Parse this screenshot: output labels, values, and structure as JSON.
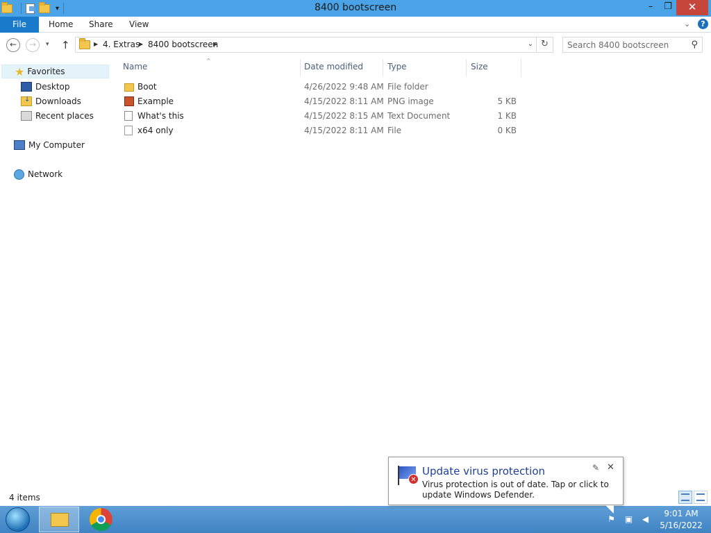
{
  "window": {
    "title": "8400 bootscreen",
    "minimize_glyph": "–",
    "maximize_glyph": "❐",
    "close_glyph": "✕"
  },
  "ribbon": {
    "tabs": [
      "File",
      "Home",
      "Share",
      "View"
    ],
    "expand_glyph": "⌄",
    "help_glyph": "?"
  },
  "address": {
    "back_glyph": "←",
    "forward_glyph": "→",
    "recent_glyph": "▾",
    "up_glyph": "↑",
    "breadcrumb": [
      "4. Extras",
      "8400 bootscreen"
    ],
    "sep_glyph": "▶",
    "dropdown_glyph": "⌄",
    "refresh_glyph": "↻",
    "search_placeholder": "Search 8400 bootscreen",
    "search_glyph": "⚲"
  },
  "navpane": {
    "favorites": "Favorites",
    "items": [
      "Desktop",
      "Downloads",
      "Recent places"
    ],
    "computer": "My Computer",
    "network": "Network"
  },
  "filelist": {
    "columns": [
      "Name",
      "Date modified",
      "Type",
      "Size"
    ],
    "sort_glyph": "^",
    "rows": [
      {
        "name": "Boot",
        "date": "4/26/2022 9:48 AM",
        "type": "File folder",
        "size": "",
        "icon": "folder-icon"
      },
      {
        "name": "Example",
        "date": "4/15/2022 8:11 AM",
        "type": "PNG image",
        "size": "5 KB",
        "icon": "png-file-icon"
      },
      {
        "name": "What's this",
        "date": "4/15/2022 8:15 AM",
        "type": "Text Document",
        "size": "1 KB",
        "icon": "text-file-icon"
      },
      {
        "name": "x64 only",
        "date": "4/15/2022 8:11 AM",
        "type": "File",
        "size": "0 KB",
        "icon": "file-icon"
      }
    ]
  },
  "status": {
    "item_count": "4 items"
  },
  "notification": {
    "title": "Update virus protection",
    "body": "Virus protection is out of date. Tap or click to update Windows Defender.",
    "settings_glyph": "✎",
    "close_glyph": "✕",
    "error_glyph": "✕"
  },
  "taskbar": {
    "time": "9:01 AM",
    "date": "5/16/2022",
    "flag_glyph": "⚑",
    "network_glyph": "▣",
    "volume_glyph": "◀"
  },
  "colors": {
    "titlebar": "#4aa3e6",
    "file_tab": "#1979ca",
    "close_button": "#c7463c",
    "taskbar": "#4f93cf",
    "notification_title": "#1f3f9a"
  }
}
